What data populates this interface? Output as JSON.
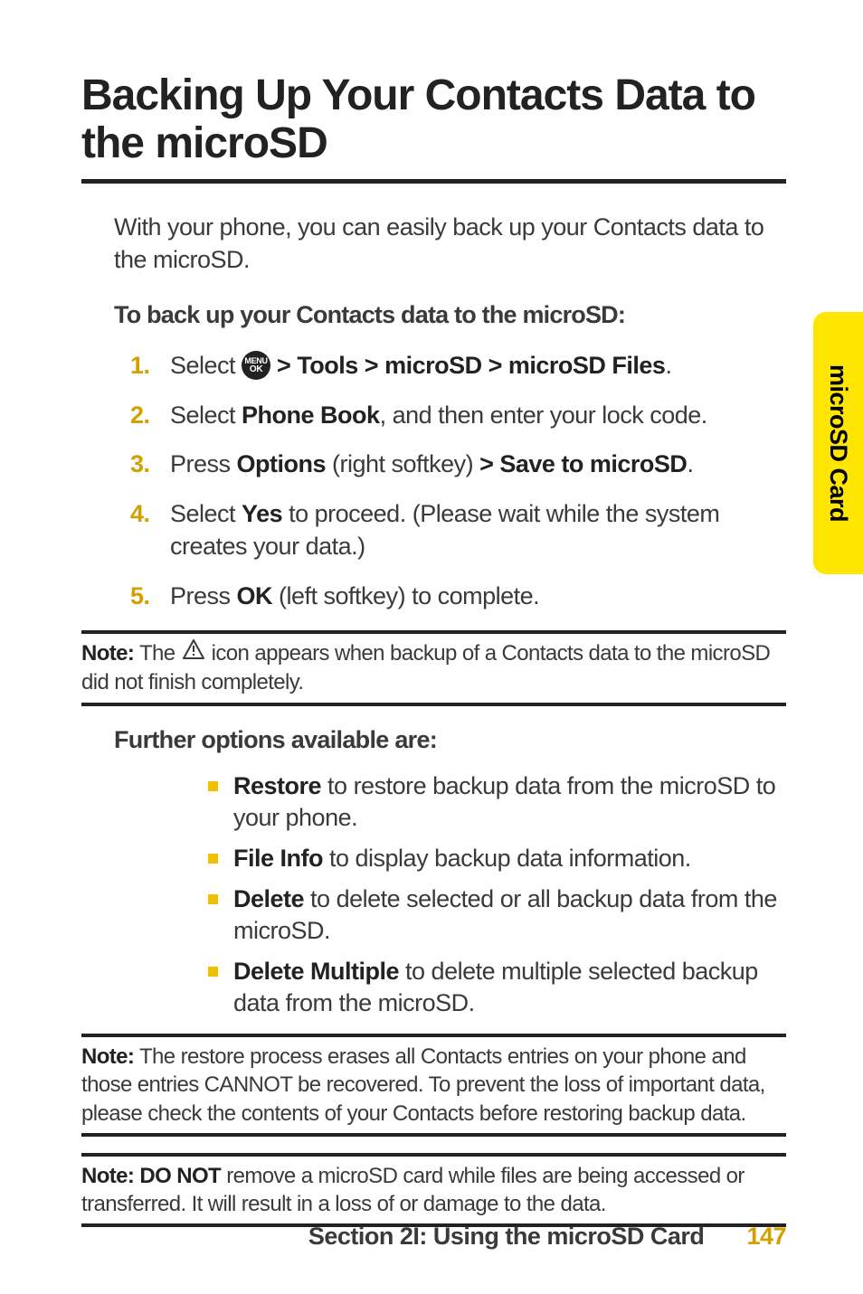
{
  "sideTab": "microSD Card",
  "title": "Backing Up Your Contacts Data to the microSD",
  "intro": "With your phone, you can easily back up your Contacts data to the microSD.",
  "subhead1": "To back up your Contacts data to the microSD:",
  "menuIcon": {
    "line1": "MENU",
    "line2": "OK"
  },
  "steps": [
    {
      "num": "1.",
      "pre": "Select ",
      "post": " > Tools > microSD > microSD Files",
      "end": "."
    },
    {
      "num": "2.",
      "a": "Select ",
      "b": "Phone Book",
      "c": ", and then enter your lock code."
    },
    {
      "num": "3.",
      "a": "Press ",
      "b": "Options",
      "c": " (right softkey) ",
      "d": "> Save to microSD",
      "e": "."
    },
    {
      "num": "4.",
      "a": "Select ",
      "b": "Yes",
      "c": " to proceed. (Please wait while the system creates your data.)"
    },
    {
      "num": "5.",
      "a": "Press ",
      "b": "OK",
      "c": " (left softkey) to complete."
    }
  ],
  "note1": {
    "label": "Note:",
    "pre": " The ",
    "post": " icon appears when backup of a Contacts data to the microSD did not finish completely."
  },
  "furtherHead": "Further options available are:",
  "bullets": [
    {
      "b": "Restore",
      "t": " to restore backup data from the microSD to your phone."
    },
    {
      "b": "File Info",
      "t": " to display backup data information."
    },
    {
      "b": "Delete",
      "t": " to delete selected or all backup data from the microSD."
    },
    {
      "b": "Delete Multiple",
      "t": " to delete multiple selected backup data from the microSD."
    }
  ],
  "note2": {
    "label": "Note:",
    "text": " The restore process erases all Contacts entries on your phone and those entries CANNOT be recovered. To prevent the loss of important data, please check the contents of your Contacts before restoring backup data."
  },
  "note3": {
    "label": "Note: DO NOT",
    "text": " remove a microSD card while files are being accessed or transferred. It will result in a loss of or damage to the data."
  },
  "footer": {
    "section": "Section 2I: Using the microSD Card",
    "page": "147"
  }
}
